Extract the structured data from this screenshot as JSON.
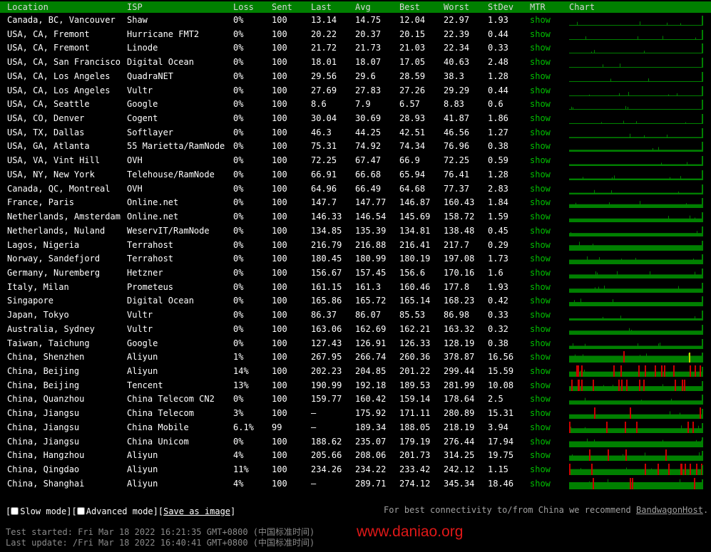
{
  "headers": {
    "location": "Location",
    "isp": "ISP",
    "loss": "Loss",
    "sent": "Sent",
    "last": "Last",
    "avg": "Avg",
    "best": "Best",
    "worst": "Worst",
    "stdev": "StDev",
    "mtr": "MTR",
    "chart": "Chart"
  },
  "colors": {
    "header_bg": "#008000",
    "show_link": "#00c000",
    "chart_ok": "#008000",
    "chart_spike": "#cc0000",
    "chart_warn": "#cccc00",
    "watermark": "#e01818"
  },
  "rows": [
    {
      "location": "Canada, BC, Vancouver",
      "isp": "Shaw",
      "loss": "0%",
      "sent": "100",
      "last": "13.14",
      "avg": "14.75",
      "best": "12.04",
      "worst": "22.97",
      "stdev": "1.93",
      "mtr": "show",
      "lossLevel": 0
    },
    {
      "location": "USA, CA, Fremont",
      "isp": "Hurricane FMT2",
      "loss": "0%",
      "sent": "100",
      "last": "20.22",
      "avg": "20.37",
      "best": "20.15",
      "worst": "22.39",
      "stdev": "0.44",
      "mtr": "show",
      "lossLevel": 0
    },
    {
      "location": "USA, CA, Fremont",
      "isp": "Linode",
      "loss": "0%",
      "sent": "100",
      "last": "21.72",
      "avg": "21.73",
      "best": "21.03",
      "worst": "22.34",
      "stdev": "0.33",
      "mtr": "show",
      "lossLevel": 0
    },
    {
      "location": "USA, CA, San Francisco",
      "isp": "Digital Ocean",
      "loss": "0%",
      "sent": "100",
      "last": "18.01",
      "avg": "18.07",
      "best": "17.05",
      "worst": "40.63",
      "stdev": "2.48",
      "mtr": "show",
      "lossLevel": 0
    },
    {
      "location": "USA, CA, Los Angeles",
      "isp": "QuadraNET",
      "loss": "0%",
      "sent": "100",
      "last": "29.56",
      "avg": "29.6",
      "best": "28.59",
      "worst": "38.3",
      "stdev": "1.28",
      "mtr": "show",
      "lossLevel": 0
    },
    {
      "location": "USA, CA, Los Angeles",
      "isp": "Vultr",
      "loss": "0%",
      "sent": "100",
      "last": "27.69",
      "avg": "27.83",
      "best": "27.26",
      "worst": "29.29",
      "stdev": "0.44",
      "mtr": "show",
      "lossLevel": 0
    },
    {
      "location": "USA, CA, Seattle",
      "isp": "Google",
      "loss": "0%",
      "sent": "100",
      "last": "8.6",
      "avg": "7.9",
      "best": "6.57",
      "worst": "8.83",
      "stdev": "0.6",
      "mtr": "show",
      "lossLevel": 0
    },
    {
      "location": "USA, CO, Denver",
      "isp": "Cogent",
      "loss": "0%",
      "sent": "100",
      "last": "30.04",
      "avg": "30.69",
      "best": "28.93",
      "worst": "41.87",
      "stdev": "1.86",
      "mtr": "show",
      "lossLevel": 0
    },
    {
      "location": "USA, TX, Dallas",
      "isp": "Softlayer",
      "loss": "0%",
      "sent": "100",
      "last": "46.3",
      "avg": "44.25",
      "best": "42.51",
      "worst": "46.56",
      "stdev": "1.27",
      "mtr": "show",
      "lossLevel": 0
    },
    {
      "location": "USA, GA, Atlanta",
      "isp": "55 Marietta/RamNode",
      "loss": "0%",
      "sent": "100",
      "last": "75.31",
      "avg": "74.92",
      "best": "74.34",
      "worst": "76.96",
      "stdev": "0.38",
      "mtr": "show",
      "lossLevel": 0
    },
    {
      "location": "USA, VA, Vint Hill",
      "isp": "OVH",
      "loss": "0%",
      "sent": "100",
      "last": "72.25",
      "avg": "67.47",
      "best": "66.9",
      "worst": "72.25",
      "stdev": "0.59",
      "mtr": "show",
      "lossLevel": 0
    },
    {
      "location": "USA, NY, New York",
      "isp": "Telehouse/RamNode",
      "loss": "0%",
      "sent": "100",
      "last": "66.91",
      "avg": "66.68",
      "best": "65.94",
      "worst": "76.41",
      "stdev": "1.28",
      "mtr": "show",
      "lossLevel": 0
    },
    {
      "location": "Canada, QC, Montreal",
      "isp": "OVH",
      "loss": "0%",
      "sent": "100",
      "last": "64.96",
      "avg": "66.49",
      "best": "64.68",
      "worst": "77.37",
      "stdev": "2.83",
      "mtr": "show",
      "lossLevel": 0
    },
    {
      "location": "France, Paris",
      "isp": "Online.net",
      "loss": "0%",
      "sent": "100",
      "last": "147.7",
      "avg": "147.77",
      "best": "146.87",
      "worst": "160.43",
      "stdev": "1.84",
      "mtr": "show",
      "lossLevel": 0
    },
    {
      "location": "Netherlands, Amsterdam",
      "isp": "Online.net",
      "loss": "0%",
      "sent": "100",
      "last": "146.33",
      "avg": "146.54",
      "best": "145.69",
      "worst": "158.72",
      "stdev": "1.59",
      "mtr": "show",
      "lossLevel": 0
    },
    {
      "location": "Netherlands, Nuland",
      "isp": "WeservIT/RamNode",
      "loss": "0%",
      "sent": "100",
      "last": "134.85",
      "avg": "135.39",
      "best": "134.81",
      "worst": "138.48",
      "stdev": "0.45",
      "mtr": "show",
      "lossLevel": 0
    },
    {
      "location": "Lagos, Nigeria",
      "isp": "Terrahost",
      "loss": "0%",
      "sent": "100",
      "last": "216.79",
      "avg": "216.88",
      "best": "216.41",
      "worst": "217.7",
      "stdev": "0.29",
      "mtr": "show",
      "lossLevel": 0
    },
    {
      "location": "Norway, Sandefjord",
      "isp": "Terrahost",
      "loss": "0%",
      "sent": "100",
      "last": "180.45",
      "avg": "180.99",
      "best": "180.19",
      "worst": "197.08",
      "stdev": "1.73",
      "mtr": "show",
      "lossLevel": 0
    },
    {
      "location": "Germany, Nuremberg",
      "isp": "Hetzner",
      "loss": "0%",
      "sent": "100",
      "last": "156.67",
      "avg": "157.45",
      "best": "156.6",
      "worst": "170.16",
      "stdev": "1.6",
      "mtr": "show",
      "lossLevel": 0
    },
    {
      "location": "Italy, Milan",
      "isp": "Prometeus",
      "loss": "0%",
      "sent": "100",
      "last": "161.15",
      "avg": "161.3",
      "best": "160.46",
      "worst": "177.8",
      "stdev": "1.93",
      "mtr": "show",
      "lossLevel": 0
    },
    {
      "location": "Singapore",
      "isp": "Digital Ocean",
      "loss": "0%",
      "sent": "100",
      "last": "165.86",
      "avg": "165.72",
      "best": "165.14",
      "worst": "168.23",
      "stdev": "0.42",
      "mtr": "show",
      "lossLevel": 0
    },
    {
      "location": "Japan, Tokyo",
      "isp": "Vultr",
      "loss": "0%",
      "sent": "100",
      "last": "86.37",
      "avg": "86.07",
      "best": "85.53",
      "worst": "86.98",
      "stdev": "0.33",
      "mtr": "show",
      "lossLevel": 0
    },
    {
      "location": "Australia, Sydney",
      "isp": "Vultr",
      "loss": "0%",
      "sent": "100",
      "last": "163.06",
      "avg": "162.69",
      "best": "162.21",
      "worst": "163.32",
      "stdev": "0.32",
      "mtr": "show",
      "lossLevel": 0
    },
    {
      "location": "Taiwan, Taichung",
      "isp": "Google",
      "loss": "0%",
      "sent": "100",
      "last": "127.43",
      "avg": "126.91",
      "best": "126.33",
      "worst": "128.19",
      "stdev": "0.38",
      "mtr": "show",
      "lossLevel": 0
    },
    {
      "location": "China, Shenzhen",
      "isp": "Aliyun",
      "loss": "1%",
      "sent": "100",
      "last": "267.95",
      "avg": "266.74",
      "best": "260.36",
      "worst": "378.87",
      "stdev": "16.56",
      "mtr": "show",
      "lossLevel": 1
    },
    {
      "location": "China, Beijing",
      "isp": "Aliyun",
      "loss": "14%",
      "sent": "100",
      "last": "202.23",
      "avg": "204.85",
      "best": "201.22",
      "worst": "299.44",
      "stdev": "15.59",
      "mtr": "show",
      "lossLevel": 14
    },
    {
      "location": "China, Beijing",
      "isp": "Tencent",
      "loss": "13%",
      "sent": "100",
      "last": "190.99",
      "avg": "192.18",
      "best": "189.53",
      "worst": "281.99",
      "stdev": "10.08",
      "mtr": "show",
      "lossLevel": 13
    },
    {
      "location": "China, Quanzhou",
      "isp": "China Telecom CN2",
      "loss": "0%",
      "sent": "100",
      "last": "159.77",
      "avg": "160.42",
      "best": "159.14",
      "worst": "178.64",
      "stdev": "2.5",
      "mtr": "show",
      "lossLevel": 0
    },
    {
      "location": "China, Jiangsu",
      "isp": "China Telecom",
      "loss": "3%",
      "sent": "100",
      "last": "–",
      "avg": "175.92",
      "best": "171.11",
      "worst": "280.89",
      "stdev": "15.31",
      "mtr": "show",
      "lossLevel": 3
    },
    {
      "location": "China, Jiangsu",
      "isp": "China Mobile",
      "loss": "6.1%",
      "sent": "99",
      "last": "–",
      "avg": "189.34",
      "best": "188.05",
      "worst": "218.19",
      "stdev": "3.94",
      "mtr": "show",
      "lossLevel": 6
    },
    {
      "location": "China, Jiangsu",
      "isp": "China Unicom",
      "loss": "0%",
      "sent": "100",
      "last": "188.62",
      "avg": "235.07",
      "best": "179.19",
      "worst": "276.44",
      "stdev": "17.94",
      "mtr": "show",
      "lossLevel": 0
    },
    {
      "location": "China, Hangzhou",
      "isp": "Aliyun",
      "loss": "4%",
      "sent": "100",
      "last": "205.66",
      "avg": "208.06",
      "best": "201.73",
      "worst": "314.25",
      "stdev": "19.75",
      "mtr": "show",
      "lossLevel": 4
    },
    {
      "location": "China, Qingdao",
      "isp": "Aliyun",
      "loss": "11%",
      "sent": "100",
      "last": "234.26",
      "avg": "234.22",
      "best": "233.42",
      "worst": "242.12",
      "stdev": "1.15",
      "mtr": "show",
      "lossLevel": 11
    },
    {
      "location": "China, Shanghai",
      "isp": "Aliyun",
      "loss": "4%",
      "sent": "100",
      "last": "–",
      "avg": "289.71",
      "best": "274.12",
      "worst": "345.34",
      "stdev": "18.46",
      "mtr": "show",
      "lossLevel": 4
    }
  ],
  "controls": {
    "open_bracket": "[",
    "slow_mode": "Slow mode",
    "sep": "][",
    "advanced_mode": "Advanced mode",
    "sep2": "][",
    "save_image": "Save as image",
    "close_bracket": "]"
  },
  "recommend": {
    "text": "For best connectivity to/from China we recommend ",
    "link": "BandwagonHost",
    "tail": "."
  },
  "info": {
    "started": "Test started: Fri Mar 18 2022 16:21:35 GMT+0800 (中国标准时间)",
    "updated": "Last update: /Fri Mar 18 2022 16:40:41 GMT+0800 (中国标准时间)"
  },
  "watermark": "www.daniao.org"
}
